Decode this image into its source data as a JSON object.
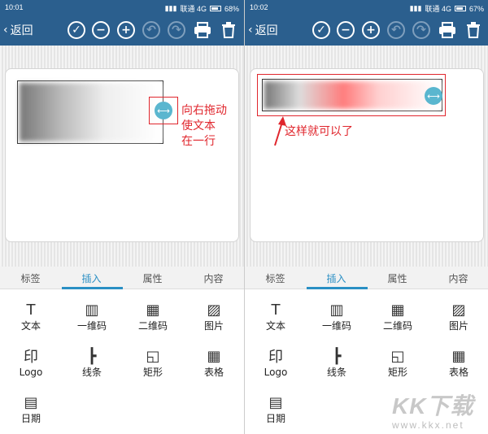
{
  "left": {
    "status": {
      "time": "10:01",
      "network": "联通 4G",
      "battery": "68%",
      "battery_level": 0.68
    },
    "annotation": [
      "向右拖动",
      "使文本",
      "在一行"
    ]
  },
  "right": {
    "status": {
      "time": "10:02",
      "network": "联通 4G",
      "battery": "67%",
      "battery_level": 0.67
    },
    "annotation": "这样就可以了"
  },
  "topbar": {
    "back_label": "返回",
    "buttons": [
      "check-icon",
      "zoom-out-icon",
      "zoom-in-icon",
      "undo-icon",
      "redo-icon",
      "print-icon",
      "trash-icon"
    ]
  },
  "tabs": [
    "标签",
    "插入",
    "属性",
    "内容"
  ],
  "active_tab": "插入",
  "insert_items": [
    {
      "label": "文本",
      "icon": "text-icon",
      "glyph": "T"
    },
    {
      "label": "一维码",
      "icon": "barcode-icon",
      "glyph": "▥"
    },
    {
      "label": "二维码",
      "icon": "qrcode-icon",
      "glyph": "▦"
    },
    {
      "label": "图片",
      "icon": "image-icon",
      "glyph": "▨"
    },
    {
      "label": "Logo",
      "icon": "logo-icon",
      "glyph": "印"
    },
    {
      "label": "线条",
      "icon": "line-icon",
      "glyph": "┣"
    },
    {
      "label": "矩形",
      "icon": "rectangle-icon",
      "glyph": "◱"
    },
    {
      "label": "表格",
      "icon": "table-icon",
      "glyph": "▦"
    },
    {
      "label": "日期",
      "icon": "calendar-icon",
      "glyph": "▤"
    }
  ],
  "watermark": {
    "logo": "KK下载",
    "url": "www.kkx.net"
  }
}
